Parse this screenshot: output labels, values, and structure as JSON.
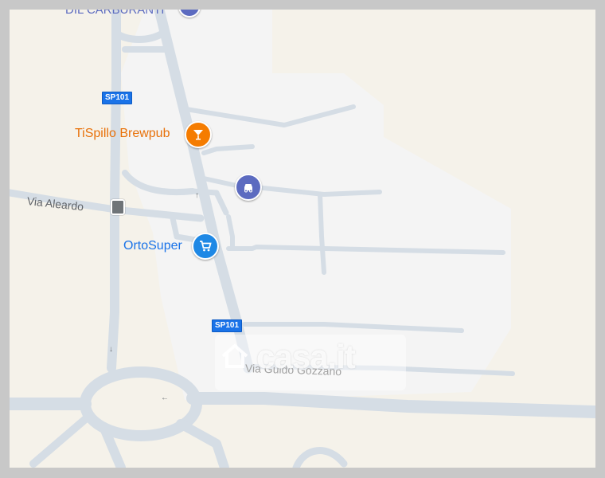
{
  "map": {
    "colors": {
      "land": "#f5f2ea",
      "area": "#f4f4f4",
      "road": "#d5dde5",
      "road_edge": "#c7d1da",
      "shield": "#1a73e8",
      "food_pin": "#f57c00",
      "shop_pin": "#1e88e5",
      "car_pin": "#5c6bc0"
    },
    "top_label": "DIL CARBURANTI",
    "roads": [
      {
        "id": "sp101-top",
        "label": "SP101"
      },
      {
        "id": "sp101-bottom",
        "label": "SP101"
      },
      {
        "id": "via-aleardo",
        "label": "Via Aleardo"
      },
      {
        "id": "via-guido-gozzano",
        "label": "Via Guido Gozzano"
      }
    ],
    "pois": [
      {
        "name": "TiSpillo Brewpub",
        "icon": "cocktail-icon",
        "color": "#f57c00"
      },
      {
        "name": "OrtoSuper",
        "icon": "shopping-cart-icon",
        "color": "#1e88e5"
      },
      {
        "name": "",
        "icon": "car-icon",
        "color": "#5c6bc0"
      }
    ],
    "watermark": "casa.it"
  }
}
